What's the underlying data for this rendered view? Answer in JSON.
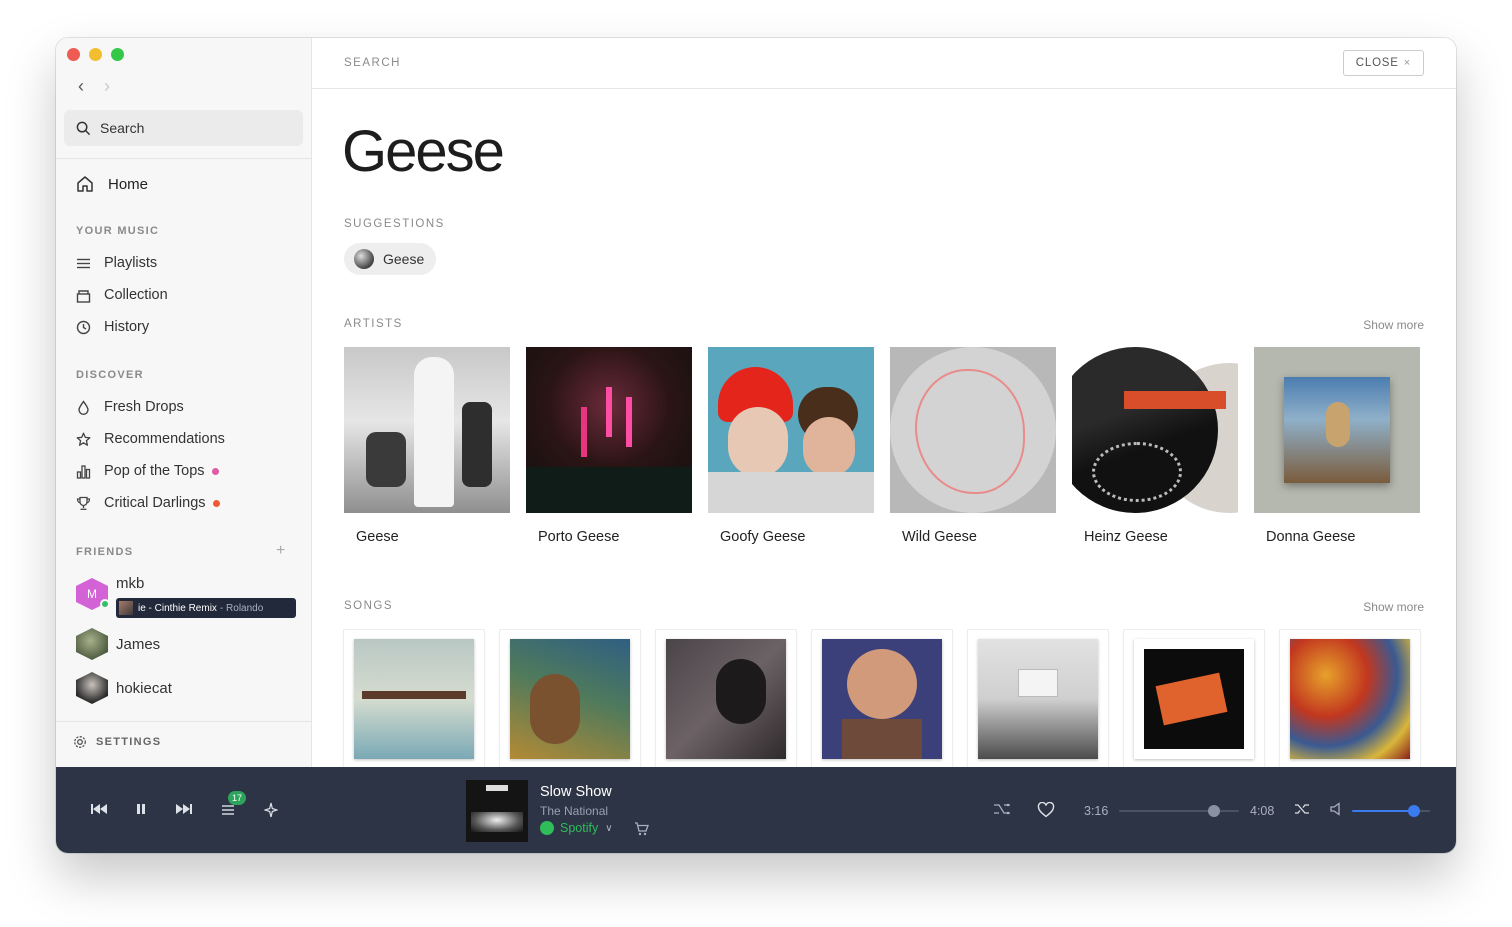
{
  "colors": {
    "accent": "#3a7bf0",
    "spotify": "#2ebd59",
    "player_bg": "#2d3445",
    "dot_pink": "#e05aa8",
    "dot_red": "#f05a35"
  },
  "sidebar": {
    "search_label": "Search",
    "home_label": "Home",
    "your_music": {
      "title": "YOUR MUSIC",
      "items": [
        {
          "label": "Playlists",
          "icon": "list-icon"
        },
        {
          "label": "Collection",
          "icon": "collection-icon"
        },
        {
          "label": "History",
          "icon": "clock-icon"
        }
      ]
    },
    "discover": {
      "title": "DISCOVER",
      "items": [
        {
          "label": "Fresh Drops",
          "icon": "drop-icon"
        },
        {
          "label": "Recommendations",
          "icon": "star-icon"
        },
        {
          "label": "Pop of the Tops",
          "icon": "bar-chart-icon"
        },
        {
          "label": "Critical Darlings",
          "icon": "trophy-icon"
        }
      ]
    },
    "friends": {
      "title": "FRIENDS",
      "items": [
        {
          "name": "mkb",
          "initial": "M"
        },
        {
          "name": "James"
        },
        {
          "name": "hokiecat"
        }
      ],
      "now_playing_track": "ie - Cinthie Remix",
      "now_playing_artist": "- Rolando"
    },
    "settings_label": "SETTINGS"
  },
  "main": {
    "breadcrumb": "SEARCH",
    "close_label": "CLOSE",
    "query": "Geese",
    "suggestions_label": "SUGGESTIONS",
    "suggestion": "Geese",
    "artists_label": "ARTISTS",
    "show_more": "Show more",
    "artists": [
      "Geese",
      "Porto Geese",
      "Goofy Geese",
      "Wild Geese",
      "Heinz Geese",
      "Donna Geese"
    ],
    "songs_label": "SONGS",
    "song_count": 7
  },
  "player": {
    "queue_count": "17",
    "title": "Slow Show",
    "artist": "The National",
    "source": "Spotify",
    "elapsed": "3:16",
    "duration": "4:08",
    "progress": 0.79,
    "volume": 0.8
  }
}
